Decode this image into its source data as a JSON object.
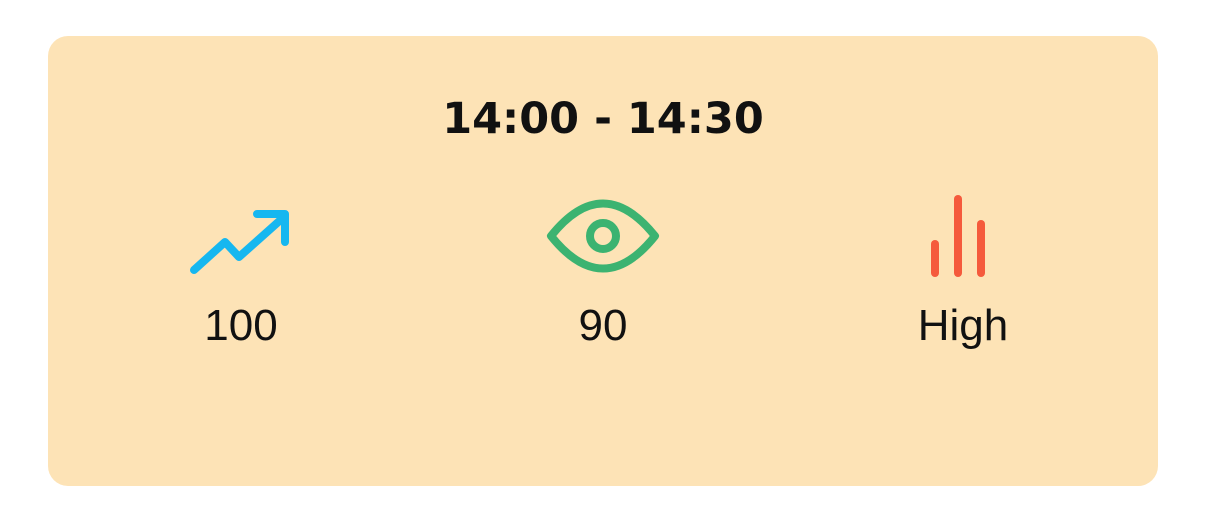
{
  "card": {
    "time_range": "14:00 - 14:30",
    "background": "#fde3b6"
  },
  "metrics": [
    {
      "icon": "trending-up-icon",
      "value": "100",
      "color": "#16b7f0"
    },
    {
      "icon": "eye-icon",
      "value": "90",
      "color": "#3cb371"
    },
    {
      "icon": "bar-level-icon",
      "value": "High",
      "color": "#f55a3c"
    }
  ]
}
